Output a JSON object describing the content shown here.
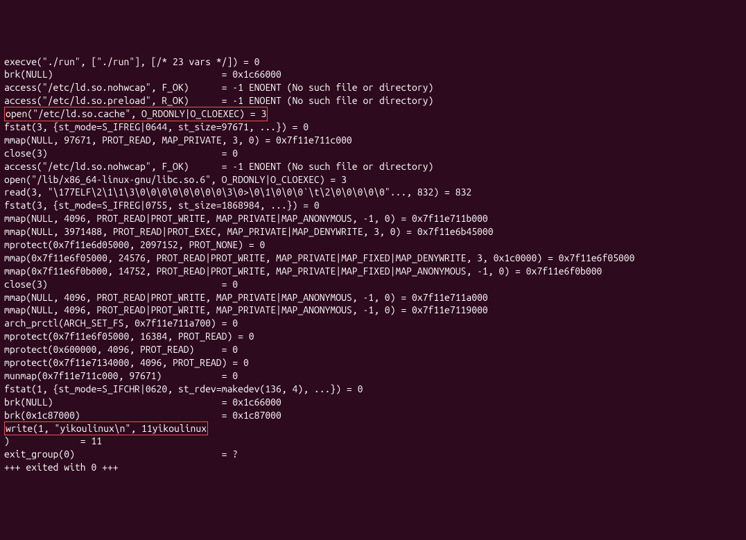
{
  "terminal": {
    "lines": [
      "execve(\"./run\", [\"./run\"], [/* 23 vars */]) = 0",
      "brk(NULL)                               = 0x1c66000",
      "access(\"/etc/ld.so.nohwcap\", F_OK)      = -1 ENOENT (No such file or directory)",
      "access(\"/etc/ld.so.preload\", R_OK)      = -1 ENOENT (No such file or directory)",
      "open(\"/etc/ld.so.cache\", O_RDONLY|O_CLOEXEC) = 3",
      "fstat(3, {st_mode=S_IFREG|0644, st_size=97671, ...}) = 0",
      "mmap(NULL, 97671, PROT_READ, MAP_PRIVATE, 3, 0) = 0x7f11e711c000",
      "close(3)                                = 0",
      "access(\"/etc/ld.so.nohwcap\", F_OK)      = -1 ENOENT (No such file or directory)",
      "open(\"/lib/x86_64-linux-gnu/libc.so.6\", O_RDONLY|O_CLOEXEC) = 3",
      "read(3, \"\\177ELF\\2\\1\\1\\3\\0\\0\\0\\0\\0\\0\\0\\0\\3\\0>\\0\\1\\0\\0\\0`\\t\\2\\0\\0\\0\\0\\0\"..., 832) = 832",
      "fstat(3, {st_mode=S_IFREG|0755, st_size=1868984, ...}) = 0",
      "mmap(NULL, 4096, PROT_READ|PROT_WRITE, MAP_PRIVATE|MAP_ANONYMOUS, -1, 0) = 0x7f11e711b000",
      "mmap(NULL, 3971488, PROT_READ|PROT_EXEC, MAP_PRIVATE|MAP_DENYWRITE, 3, 0) = 0x7f11e6b45000",
      "mprotect(0x7f11e6d05000, 2097152, PROT_NONE) = 0",
      "mmap(0x7f11e6f05000, 24576, PROT_READ|PROT_WRITE, MAP_PRIVATE|MAP_FIXED|MAP_DENYWRITE, 3, 0x1c0000) = 0x7f11e6f05000",
      "mmap(0x7f11e6f0b000, 14752, PROT_READ|PROT_WRITE, MAP_PRIVATE|MAP_FIXED|MAP_ANONYMOUS, -1, 0) = 0x7f11e6f0b000",
      "close(3)                                = 0",
      "mmap(NULL, 4096, PROT_READ|PROT_WRITE, MAP_PRIVATE|MAP_ANONYMOUS, -1, 0) = 0x7f11e711a000",
      "mmap(NULL, 4096, PROT_READ|PROT_WRITE, MAP_PRIVATE|MAP_ANONYMOUS, -1, 0) = 0x7f11e7119000",
      "arch_prctl(ARCH_SET_FS, 0x7f11e711a700) = 0",
      "mprotect(0x7f11e6f05000, 16384, PROT_READ) = 0",
      "mprotect(0x600000, 4096, PROT_READ)     = 0",
      "mprotect(0x7f11e7134000, 4096, PROT_READ) = 0",
      "munmap(0x7f11e711c000, 97671)           = 0",
      "fstat(1, {st_mode=S_IFCHR|0620, st_rdev=makedev(136, 4), ...}) = 0",
      "brk(NULL)                               = 0x1c66000",
      "brk(0x1c87000)                          = 0x1c87000",
      "write(1, \"yikoulinux\\n\", 11yikoulinux",
      ")             = 11",
      "exit_group(0)                           = ?",
      "+++ exited with 0 +++"
    ],
    "highlighted_indices": [
      4,
      28
    ]
  }
}
